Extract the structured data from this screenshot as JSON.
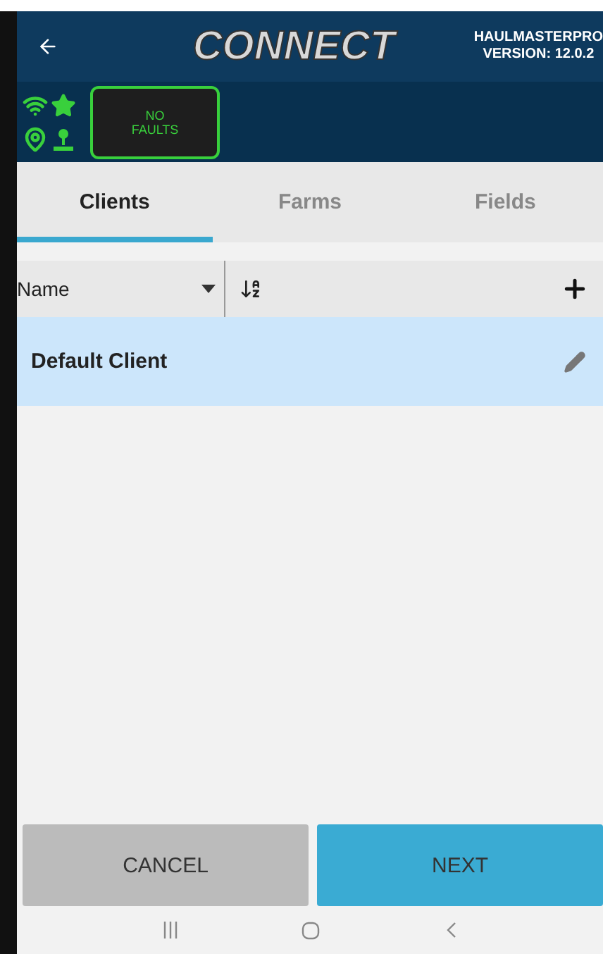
{
  "header": {
    "logo": "CONNECT",
    "product": "HAULMASTERPRO",
    "version": "VERSION: 12.0.2"
  },
  "status": {
    "fault_label": "NO\nFAULTS"
  },
  "tabs": [
    {
      "label": "Clients",
      "selected": true
    },
    {
      "label": "Farms",
      "selected": false
    },
    {
      "label": "Fields",
      "selected": false
    }
  ],
  "toolbar": {
    "sort_field": "Name"
  },
  "rows": [
    {
      "name": "Default Client",
      "selected": true
    }
  ],
  "buttons": [
    {
      "label": "CANCEL",
      "kind": "secondary"
    },
    {
      "label": "NEXT",
      "kind": "primary"
    }
  ]
}
